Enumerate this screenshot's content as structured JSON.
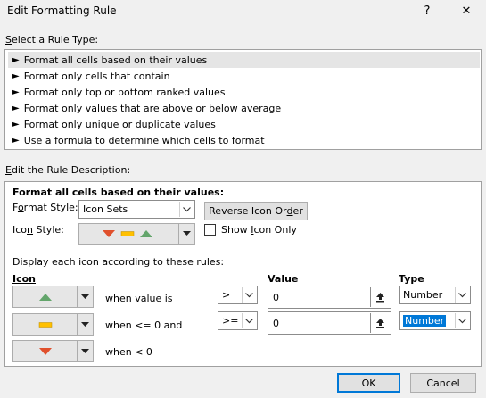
{
  "window": {
    "title": "Edit Formatting Rule",
    "help_glyph": "?",
    "close_glyph": "✕"
  },
  "rule_type": {
    "label_first": "S",
    "label_rest": "elect a Rule Type:",
    "items": [
      "Format all cells based on their values",
      "Format only cells that contain",
      "Format only top or bottom ranked values",
      "Format only values that are above or below average",
      "Format only unique or duplicate values",
      "Use a formula to determine which cells to format"
    ],
    "selected_index": 0
  },
  "description": {
    "label_first": "E",
    "label_rest": "dit the Rule Description:",
    "heading": "Format all cells based on their values:",
    "format_style_label_pre": "F",
    "format_style_label_u": "o",
    "format_style_label_post": "rmat Style:",
    "format_style_value": "Icon Sets",
    "reverse_btn_pre": "Reverse Icon Or",
    "reverse_btn_u": "d",
    "reverse_btn_post": "er",
    "icon_style_label_pre": "Ico",
    "icon_style_label_u": "n",
    "icon_style_label_post": " Style:",
    "show_icon_only_pre": "Show ",
    "show_icon_only_u": "I",
    "show_icon_only_post": "con Only",
    "show_icon_only_checked": false,
    "rules_caption": "Display each icon according to these rules:",
    "col_icon": "Icon",
    "col_value": "Value",
    "col_type": "Type",
    "rows": [
      {
        "icon": "green-triangle-up-icon",
        "color": "#63a56b",
        "condition": "when value is",
        "operator": ">",
        "value": "0",
        "type": "Number"
      },
      {
        "icon": "yellow-dash-icon",
        "color": "#ffc000",
        "condition": "when <= 0 and",
        "operator": ">=",
        "value": "0",
        "type": "Number"
      },
      {
        "icon": "red-triangle-down-icon",
        "color": "#e0502c",
        "condition": "when < 0"
      }
    ]
  },
  "footer": {
    "ok_label": "OK",
    "cancel_label": "Cancel"
  }
}
